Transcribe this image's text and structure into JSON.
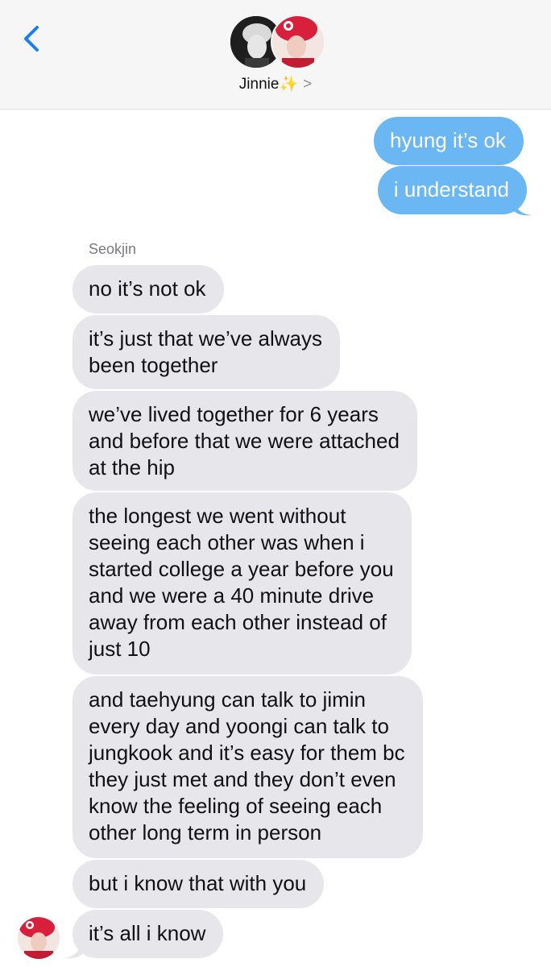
{
  "header": {
    "contact_name": "Jinnie",
    "sparkle": "✨",
    "chevron": ">",
    "back_icon": "chevron-left-icon",
    "accent": "#1a7ef5"
  },
  "colors": {
    "sent_bubble": "#6ab7f4",
    "received_bubble": "#e6e6eb",
    "header_bg": "#f6f6f7"
  },
  "sent_messages": [
    {
      "text": "hyung it’s ok"
    },
    {
      "text": "i understand"
    }
  ],
  "received_sender": "Seokjin",
  "received_messages": [
    {
      "lines": [
        "no it’s not ok"
      ]
    },
    {
      "lines": [
        "it’s just that we’ve always",
        "been together"
      ]
    },
    {
      "lines": [
        "we’ve lived together for 6 years",
        "and before that we were attached",
        "at the hip"
      ]
    },
    {
      "lines": [
        "the longest we went without",
        "seeing each other was when i",
        "started college a year before you",
        "and we were a 40 minute drive",
        "away from each other instead of",
        "just 10"
      ]
    },
    {
      "lines": [
        "and taehyung can talk to jimin",
        "every day and yoongi can talk to",
        "jungkook and it’s easy for them bc",
        "they just met and they don’t even",
        "know the feeling of seeing each",
        "other long term in person"
      ]
    },
    {
      "lines": [
        "but i know that with you"
      ]
    },
    {
      "lines": [
        "it’s all i know"
      ]
    }
  ]
}
